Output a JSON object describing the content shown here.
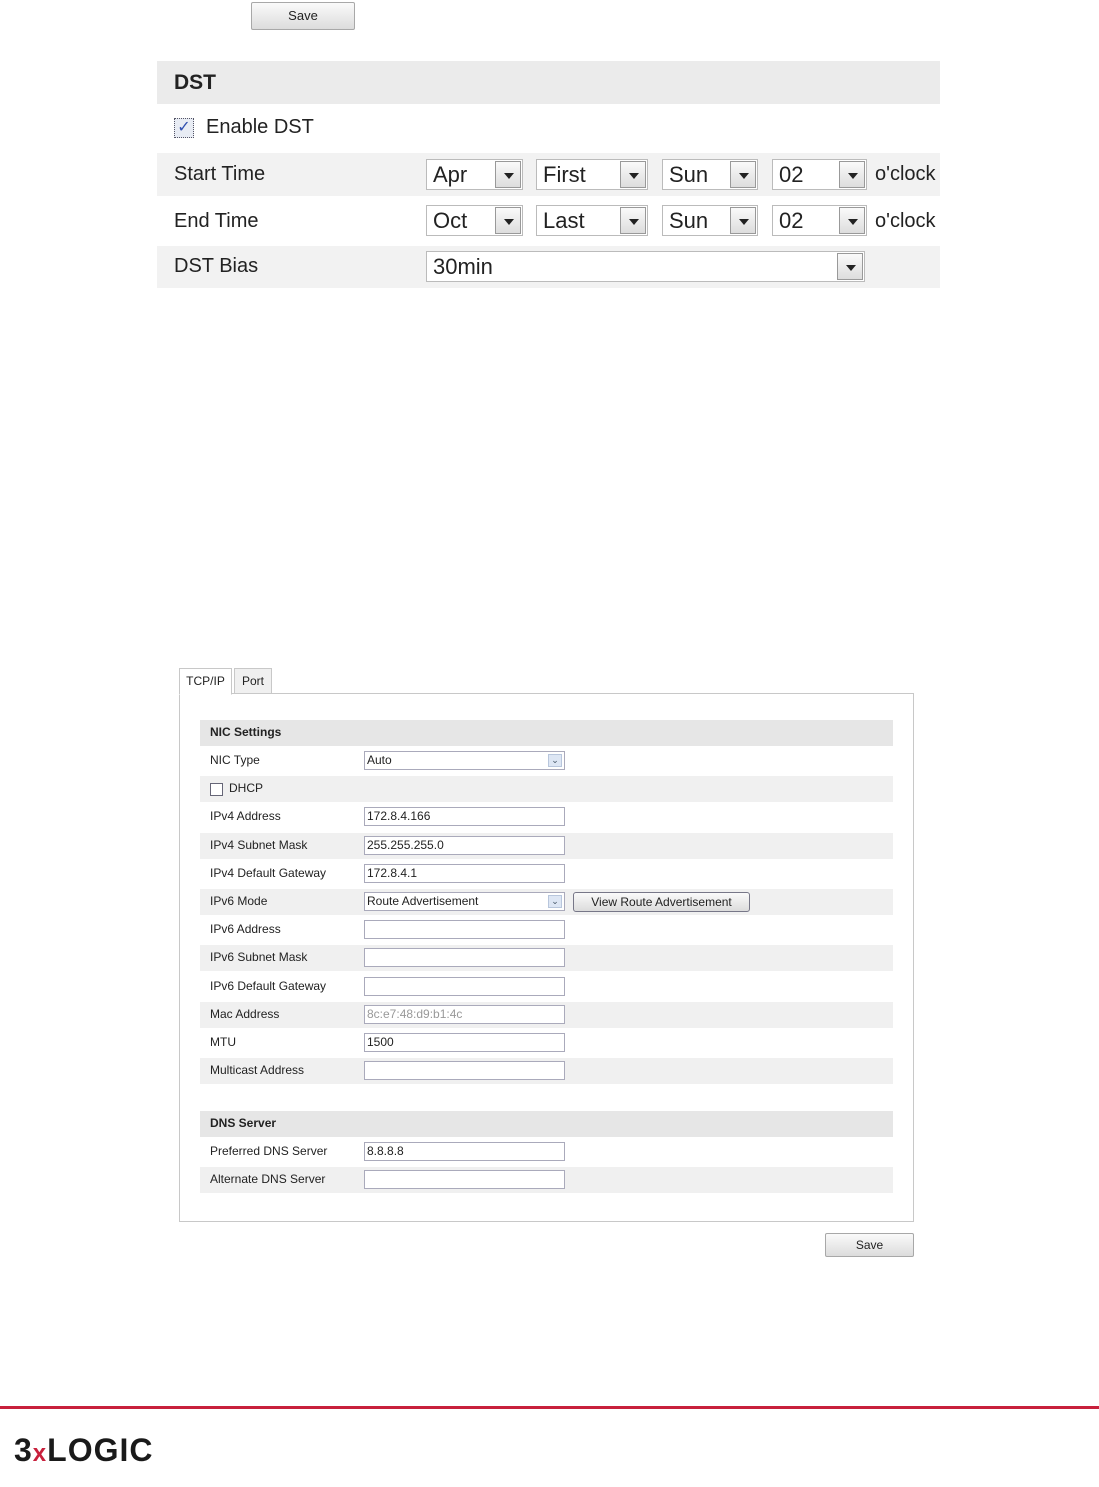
{
  "dst": {
    "save_label": "Save",
    "title": "DST",
    "enable_label": "Enable DST",
    "enabled": true,
    "start_label": "Start Time",
    "start": [
      "Apr",
      "First",
      "Sun",
      "02"
    ],
    "end_label": "End Time",
    "end": [
      "Oct",
      "Last",
      "Sun",
      "02"
    ],
    "oclock": "o'clock",
    "bias_label": "DST Bias",
    "bias": "30min"
  },
  "network": {
    "tabs": [
      "TCP/IP",
      "Port"
    ],
    "nic_header": "NIC Settings",
    "rows": [
      {
        "label": "NIC Type",
        "value": "Auto",
        "type": "select"
      },
      {
        "label": "DHCP",
        "type": "checkbox",
        "checked": false
      },
      {
        "label": "IPv4 Address",
        "value": "172.8.4.166",
        "type": "input"
      },
      {
        "label": "IPv4 Subnet Mask",
        "value": "255.255.255.0",
        "type": "input"
      },
      {
        "label": "IPv4 Default Gateway",
        "value": "172.8.4.1",
        "type": "input"
      },
      {
        "label": "IPv6 Mode",
        "value": "Route Advertisement",
        "type": "select",
        "button": "View Route Advertisement"
      },
      {
        "label": "IPv6 Address",
        "value": "",
        "type": "input"
      },
      {
        "label": "IPv6 Subnet Mask",
        "value": "",
        "type": "input"
      },
      {
        "label": "IPv6 Default Gateway",
        "value": "",
        "type": "input"
      },
      {
        "label": "Mac Address",
        "value": "8c:e7:48:d9:b1:4c",
        "type": "disabled"
      },
      {
        "label": "MTU",
        "value": "1500",
        "type": "input"
      },
      {
        "label": "Multicast Address",
        "value": "",
        "type": "input"
      }
    ],
    "dns_header": "DNS Server",
    "dns_rows": [
      {
        "label": "Preferred DNS Server",
        "value": "8.8.8.8",
        "type": "input"
      },
      {
        "label": "Alternate DNS Server",
        "value": "",
        "type": "input"
      }
    ],
    "save_label": "Save"
  },
  "footer": {
    "logo": "3xLOGIC",
    "accent": "#c8203c"
  }
}
